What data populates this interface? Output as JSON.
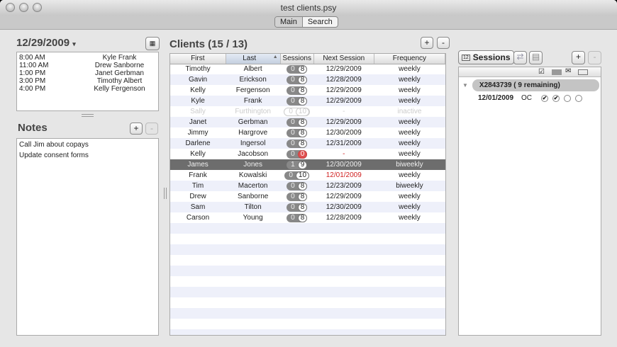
{
  "window": {
    "title": "test clients.psy"
  },
  "toolbar": {
    "tabs": [
      {
        "label": "Main"
      },
      {
        "label": "Search"
      }
    ]
  },
  "schedule": {
    "date": "12/29/2009",
    "date_dropdown": "▾",
    "appointments": [
      {
        "time": "8:00 AM",
        "name": "Kyle Frank"
      },
      {
        "time": "11:00 AM",
        "name": "Drew Sanborne"
      },
      {
        "time": "1:00 PM",
        "name": "Janet Gerbman"
      },
      {
        "time": "3:00 PM",
        "name": "Timothy Albert"
      },
      {
        "time": "4:00 PM",
        "name": "Kelly Fergenson"
      }
    ]
  },
  "notes": {
    "title": "Notes",
    "add": "+",
    "remove": "-",
    "items": [
      "Call Jim about copays",
      "Update consent forms"
    ]
  },
  "clients": {
    "title": "Clients (15 / 13)",
    "add": "+",
    "remove": "-",
    "columns": [
      "First",
      "Last",
      "Sessions",
      "Next Session",
      "Frequency"
    ],
    "sort_indicator": "▲",
    "rows": [
      {
        "first": "Timothy",
        "last": "Albert",
        "used": "0",
        "left": "8",
        "next": "12/29/2009",
        "freq": "weekly"
      },
      {
        "first": "Gavin",
        "last": "Erickson",
        "used": "0",
        "left": "8",
        "next": "12/28/2009",
        "freq": "weekly"
      },
      {
        "first": "Kelly",
        "last": "Fergenson",
        "used": "0",
        "left": "8",
        "next": "12/29/2009",
        "freq": "weekly"
      },
      {
        "first": "Kyle",
        "last": "Frank",
        "used": "0",
        "left": "8",
        "next": "12/29/2009",
        "freq": "weekly"
      },
      {
        "first": "Sally",
        "last": "Furthington",
        "used": "0",
        "left": "10",
        "next": "-",
        "freq": "inactive",
        "state": "inactive"
      },
      {
        "first": "Janet",
        "last": "Gerbman",
        "used": "0",
        "left": "8",
        "next": "12/29/2009",
        "freq": "weekly"
      },
      {
        "first": "Jimmy",
        "last": "Hargrove",
        "used": "0",
        "left": "8",
        "next": "12/30/2009",
        "freq": "weekly"
      },
      {
        "first": "Darlene",
        "last": "Ingersol",
        "used": "0",
        "left": "8",
        "next": "12/31/2009",
        "freq": "weekly"
      },
      {
        "first": "Kelly",
        "last": "Jacobson",
        "used": "0",
        "left": "0",
        "next": "-",
        "freq": "weekly",
        "state": "empty"
      },
      {
        "first": "James",
        "last": "Jones",
        "used": "1",
        "left": "9",
        "next": "12/30/2009",
        "freq": "biweekly",
        "state": "selected"
      },
      {
        "first": "Frank",
        "last": "Kowalski",
        "used": "0",
        "left": "10",
        "next": "12/01/2009",
        "freq": "weekly",
        "state": "overdue"
      },
      {
        "first": "Tim",
        "last": "Macerton",
        "used": "0",
        "left": "8",
        "next": "12/23/2009",
        "freq": "biweekly"
      },
      {
        "first": "Drew",
        "last": "Sanborne",
        "used": "0",
        "left": "8",
        "next": "12/29/2009",
        "freq": "weekly"
      },
      {
        "first": "Sam",
        "last": "Tilton",
        "used": "0",
        "left": "8",
        "next": "12/30/2009",
        "freq": "weekly"
      },
      {
        "first": "Carson",
        "last": "Young",
        "used": "0",
        "left": "8",
        "next": "12/28/2009",
        "freq": "weekly"
      }
    ]
  },
  "sessions": {
    "tab_label": "Sessions",
    "calendar_icon_text": "12",
    "add": "+",
    "remove": "-",
    "group": {
      "label": "X2843739  ( 9 remaining)"
    },
    "items": [
      {
        "date": "12/01/2009",
        "code": "OC",
        "checks": [
          true,
          true,
          false,
          false
        ]
      }
    ]
  }
}
